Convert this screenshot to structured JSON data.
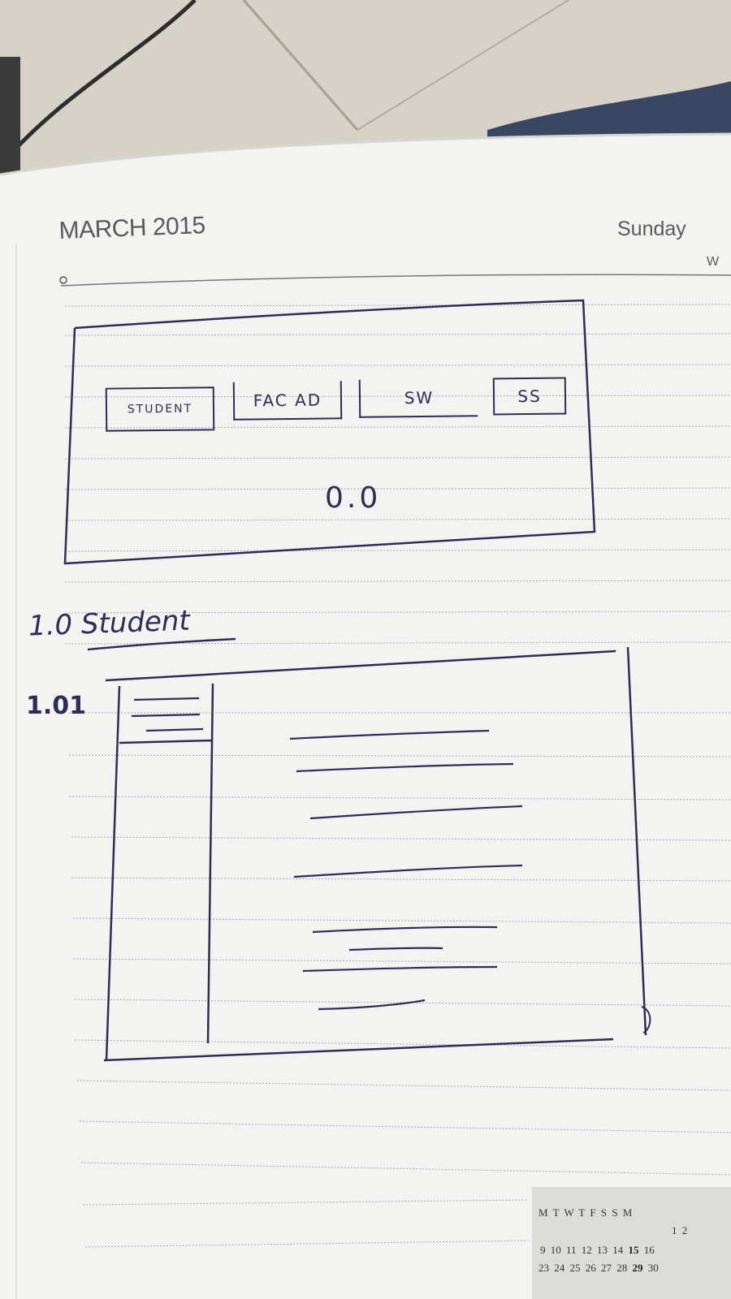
{
  "page": {
    "month_year": "MARCH 2015",
    "weekday": "Sunday",
    "margin_letter": "W"
  },
  "sketch_top": {
    "tabs": [
      "STUDENT",
      "FAC AD",
      "SW",
      "SS"
    ],
    "version": "0.0"
  },
  "sketch_student": {
    "heading": "1.0 Student",
    "sub_label": "1.01"
  },
  "calendar": {
    "weekdays": [
      "M",
      "T",
      "W",
      "T",
      "F",
      "S",
      "S",
      "M"
    ],
    "week1": [
      "1",
      "2"
    ],
    "week3": [
      "9",
      "10",
      "11",
      "12",
      "13",
      "14",
      "15",
      "16"
    ],
    "week5": [
      "23",
      "24",
      "25",
      "26",
      "27",
      "28",
      "29",
      "30"
    ]
  }
}
